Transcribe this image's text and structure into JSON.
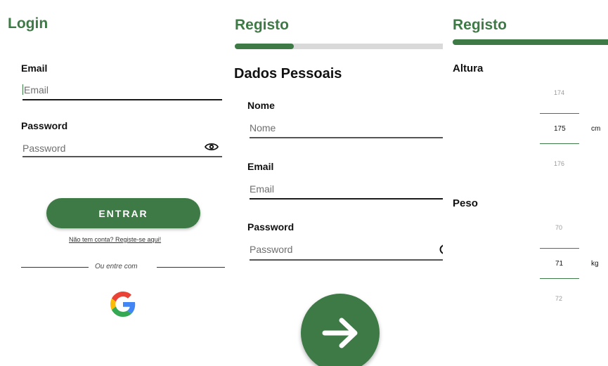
{
  "login": {
    "title": "Login",
    "email_label": "Email",
    "email_placeholder": "Email",
    "password_label": "Password",
    "password_placeholder": "Password",
    "submit_label": "ENTRAR",
    "register_link": "Não tem conta? Registe-se aqui!",
    "divider_text": "Ou entre com",
    "social_provider": "google-icon"
  },
  "register_personal": {
    "title": "Registo",
    "progress": 0.28,
    "section_title": "Dados Pessoais",
    "name_label": "Nome",
    "name_placeholder": "Nome",
    "email_label": "Email",
    "email_placeholder": "Email",
    "password_label": "Password",
    "password_placeholder": "Password",
    "next_icon": "arrow-right-icon"
  },
  "register_body": {
    "title": "Registo",
    "progress": 1.0,
    "height": {
      "label": "Altura",
      "prev": "174",
      "value": "175",
      "next": "176",
      "unit": "cm"
    },
    "weight": {
      "label": "Peso",
      "prev": "70",
      "value": "71",
      "next": "72",
      "unit": "kg"
    }
  },
  "colors": {
    "accent": "#3d7a45",
    "track": "#d9d9d9",
    "text": "#111111",
    "placeholder": "#6f6f6f"
  }
}
